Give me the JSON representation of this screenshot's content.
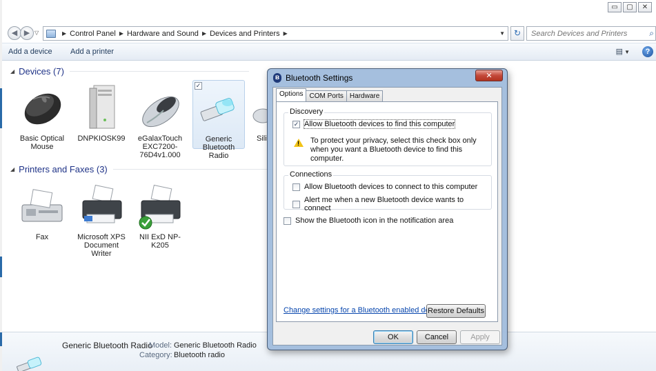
{
  "window": {
    "min_glyph": "▭",
    "max_glyph": "▢",
    "close_glyph": "✕"
  },
  "address": {
    "crumbs": [
      "Control Panel",
      "Hardware and Sound",
      "Devices and Printers"
    ],
    "search_placeholder": "Search Devices and Printers"
  },
  "commandbar": {
    "add_device": "Add a device",
    "add_printer": "Add a printer",
    "help": "?"
  },
  "groups": {
    "devices": "Devices (7)",
    "printers": "Printers and Faxes (3)"
  },
  "devices": [
    {
      "label": "Basic Optical Mouse"
    },
    {
      "label": "DNPKIOSK99"
    },
    {
      "label": "eGalaxTouch EXC7200-76D4v1.000"
    },
    {
      "label": "Generic Bluetooth Radio"
    },
    {
      "label": "Sili"
    }
  ],
  "printers": [
    {
      "label": "Fax"
    },
    {
      "label": "Microsoft XPS Document Writer"
    },
    {
      "label": "NII ExD NP-K205"
    }
  ],
  "details": {
    "name": "Generic Bluetooth Radio",
    "model_key": "Model:",
    "model_value": "Generic Bluetooth Radio",
    "category_key": "Category:",
    "category_value": "Bluetooth radio"
  },
  "dialog": {
    "title": "Bluetooth Settings",
    "tabs": [
      "Options",
      "COM Ports",
      "Hardware"
    ],
    "discovery_title": "Discovery",
    "allow_find": "Allow Bluetooth devices to find this computer",
    "privacy_note": "To protect your privacy, select this check box only when you want a Bluetooth device to find this computer.",
    "connections_title": "Connections",
    "allow_connect": "Allow Bluetooth devices to connect to this computer",
    "alert_connect": "Alert me when a new Bluetooth device wants to connect",
    "show_icon": "Show the Bluetooth icon in the notification area",
    "change_link": "Change settings for a Bluetooth enabled device.",
    "restore": "Restore Defaults",
    "ok": "OK",
    "cancel": "Cancel",
    "apply": "Apply",
    "allow_find_checked": true,
    "allow_connect_checked": false,
    "alert_connect_checked": false,
    "show_icon_checked": false
  },
  "colors": {
    "link": "#0645ad",
    "group_header": "#1e3287",
    "dialog_frame": "#a0bcdc"
  }
}
